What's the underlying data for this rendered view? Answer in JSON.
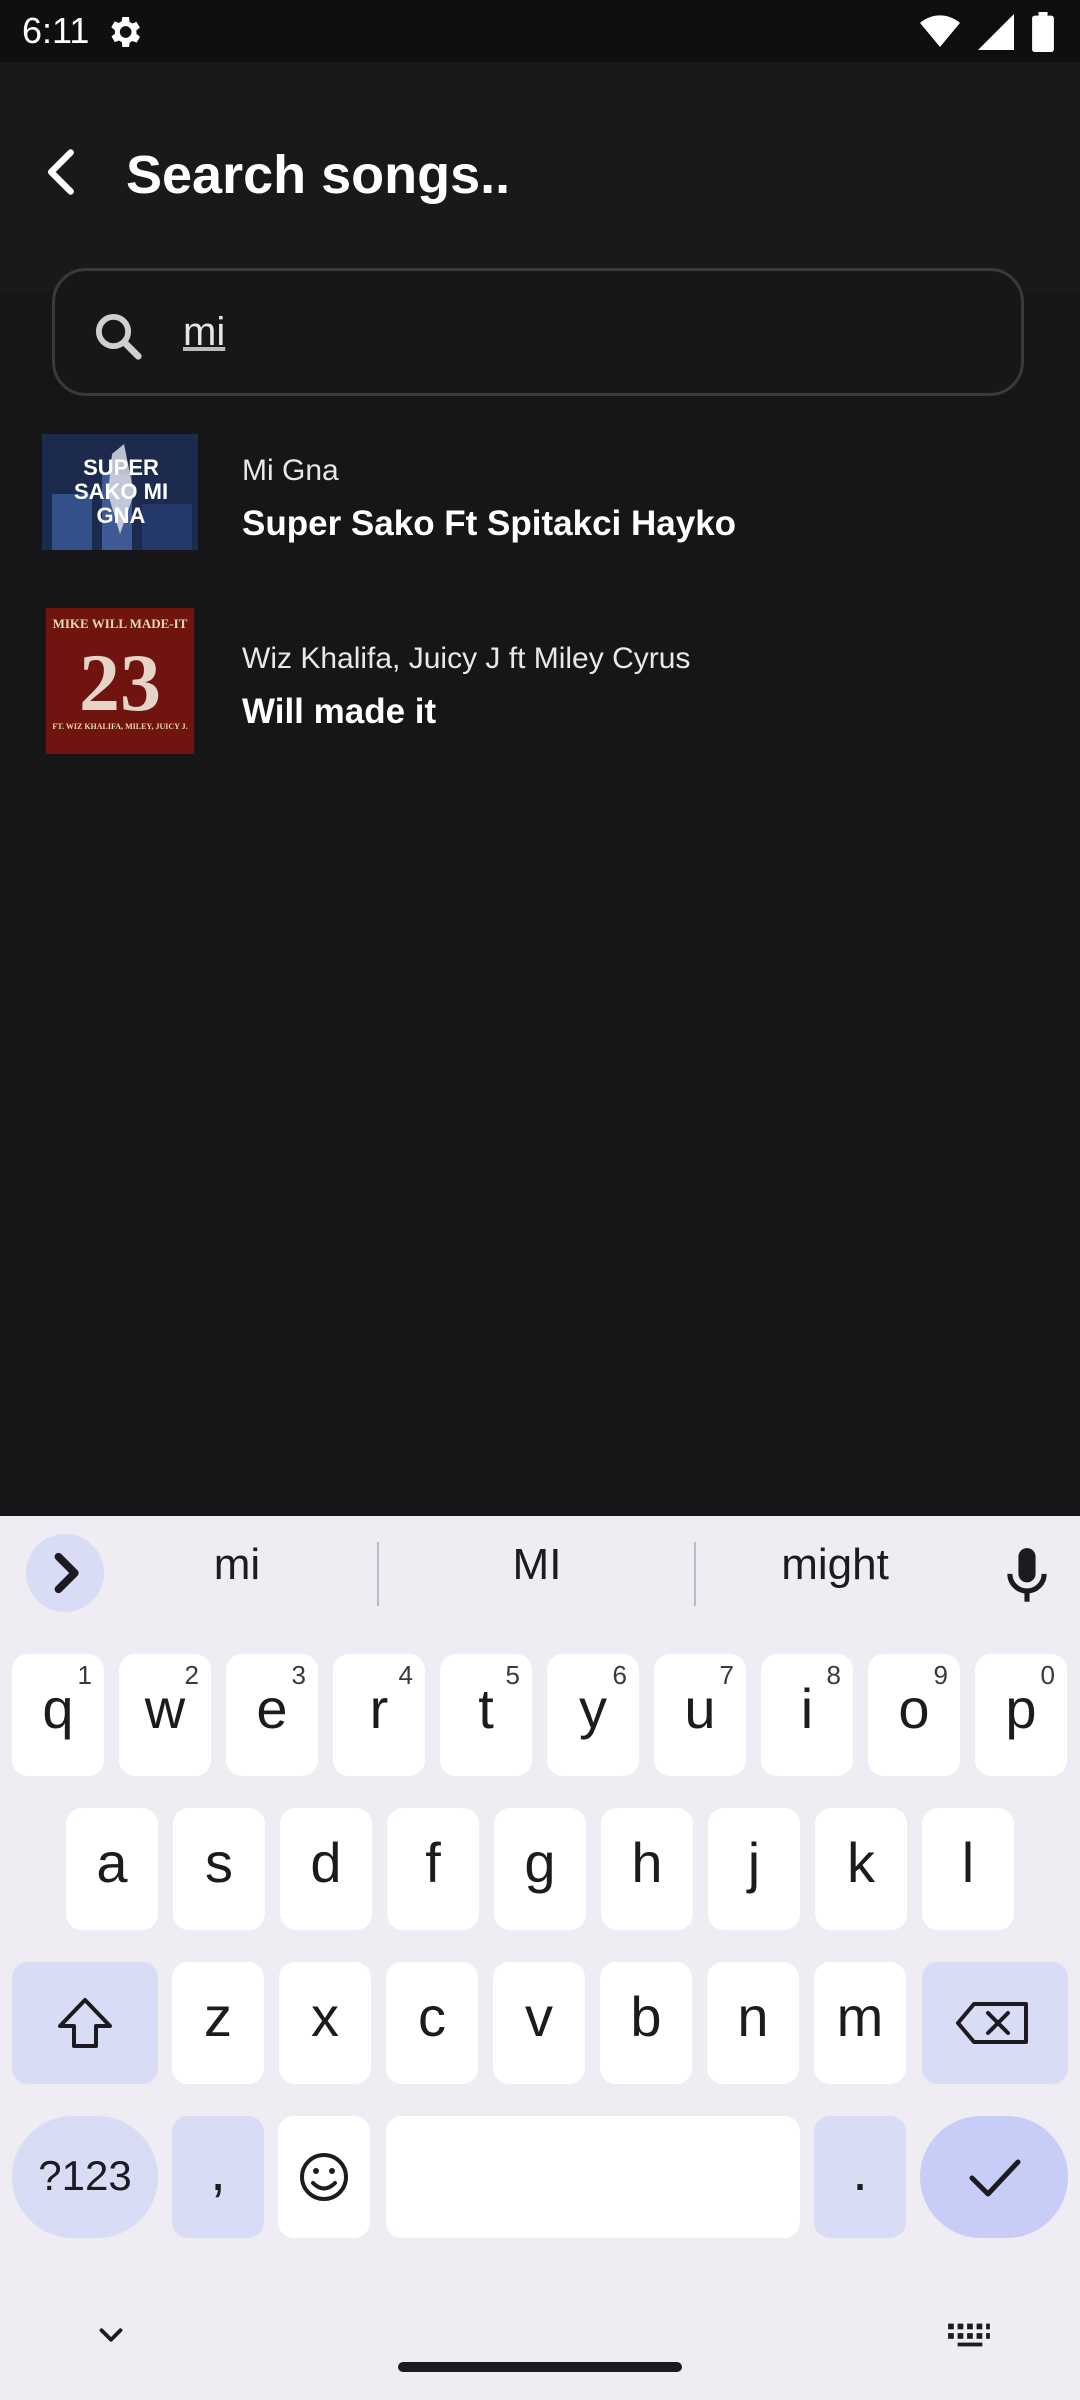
{
  "status": {
    "time": "6:11"
  },
  "appbar": {
    "title": "Search songs.."
  },
  "search": {
    "value": "mi"
  },
  "results": [
    {
      "artist": "Mi Gna",
      "title": "Super Sako Ft  Spitakci Hayko",
      "art_text": "SUPER SAKO MI GNA"
    },
    {
      "artist": "Wiz Khalifa, Juicy J ft Miley Cyrus",
      "title": "Will made it",
      "art_top": "MIKE WILL MADE-IT",
      "art_num": "23",
      "art_bottom": "FT. WIZ KHALIFA, MILEY, JUICY J."
    }
  ],
  "keyboard": {
    "suggestions": [
      "mi",
      "MI",
      "might"
    ],
    "row1": [
      {
        "k": "q",
        "s": "1"
      },
      {
        "k": "w",
        "s": "2"
      },
      {
        "k": "e",
        "s": "3"
      },
      {
        "k": "r",
        "s": "4"
      },
      {
        "k": "t",
        "s": "5"
      },
      {
        "k": "y",
        "s": "6"
      },
      {
        "k": "u",
        "s": "7"
      },
      {
        "k": "i",
        "s": "8"
      },
      {
        "k": "o",
        "s": "9"
      },
      {
        "k": "p",
        "s": "0"
      }
    ],
    "row2": [
      "a",
      "s",
      "d",
      "f",
      "g",
      "h",
      "j",
      "k",
      "l"
    ],
    "row3": [
      "z",
      "x",
      "c",
      "v",
      "b",
      "n",
      "m"
    ],
    "symbols_label": "?123",
    "comma": ",",
    "period": "."
  },
  "colors": {
    "background": "#161618",
    "accent_key": "#d8dcf4",
    "keyboard_bg": "#efecf4"
  }
}
